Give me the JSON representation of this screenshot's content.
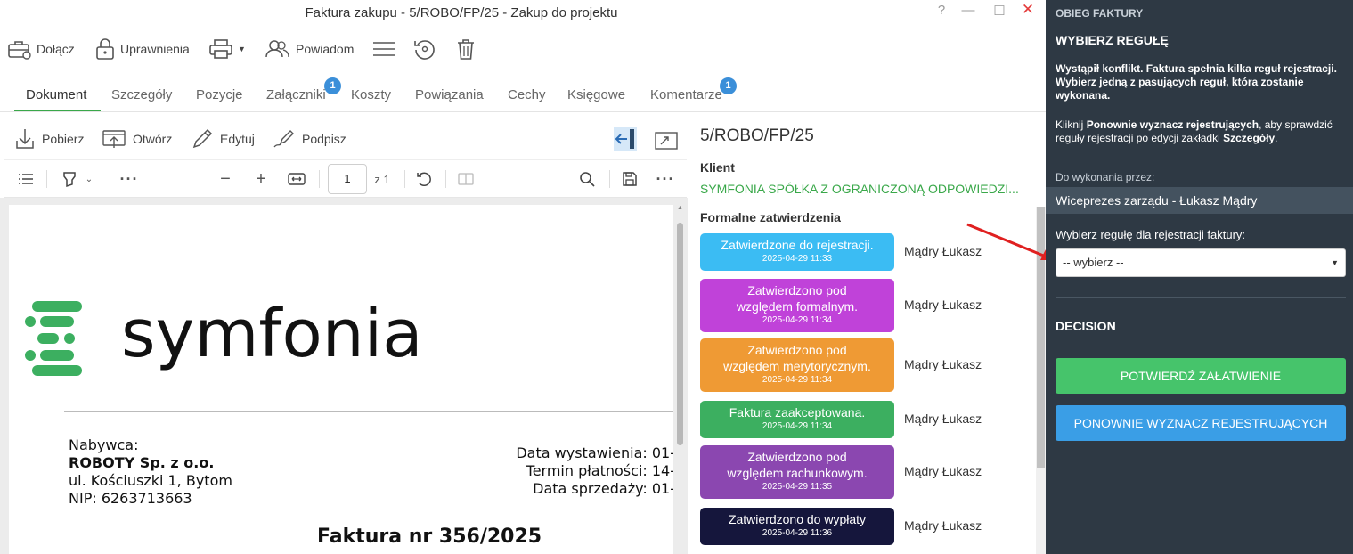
{
  "window": {
    "title": "Faktura zakupu - 5/ROBO/FP/25 - Zakup do projektu",
    "help": "?",
    "minimize": "—",
    "maximize": "☐",
    "close": "✕"
  },
  "toolbar": {
    "attach": "Dołącz",
    "permissions": "Uprawnienia",
    "notify": "Powiadom"
  },
  "tabs": [
    {
      "label": "Dokument"
    },
    {
      "label": "Szczegóły"
    },
    {
      "label": "Pozycje"
    },
    {
      "label": "Załączniki",
      "badge": "1"
    },
    {
      "label": "Koszty"
    },
    {
      "label": "Powiązania"
    },
    {
      "label": "Cechy"
    },
    {
      "label": "Księgowe"
    },
    {
      "label": "Komentarze",
      "badge": "1"
    }
  ],
  "doc_actions": {
    "download": "Pobierz",
    "open": "Otwórz",
    "edit": "Edytuj",
    "sign": "Podpisz"
  },
  "pdf_toolbar": {
    "page": "1",
    "of_pages": "z 1"
  },
  "invoice": {
    "logo_text": "symfonia",
    "buyer_label": "Nabywca:",
    "buyer_name": "ROBOTY Sp. z o.o.",
    "buyer_address": "ul. Kościuszki 1, Bytom",
    "buyer_nip": "NIP: 6263713663",
    "issue_date": "Data wystawienia: 01-",
    "due_date": "Termin płatności: 14-",
    "sale_date": "Data sprzedaży: 01-",
    "number": "Faktura nr 356/2025"
  },
  "details": {
    "doc_number": "5/ROBO/FP/25",
    "client_label": "Klient",
    "client_name": "SYMFONIA SPÓŁKA Z OGRANICZONĄ ODPOWIEDZI...",
    "approvals_label": "Formalne zatwierdzenia",
    "approvals": [
      {
        "line1": "Zatwierdzone do rejestracji.",
        "line2": "",
        "date": "2025-04-29 11:33",
        "user": "Mądry Łukasz",
        "color": "#3bbcf3"
      },
      {
        "line1": "Zatwierdzono pod",
        "line2": "względem formalnym.",
        "date": "2025-04-29 11:34",
        "user": "Mądry Łukasz",
        "color": "#c042d9"
      },
      {
        "line1": "Zatwierdzono pod",
        "line2": "względem merytorycznym.",
        "date": "2025-04-29 11:34",
        "user": "Mądry Łukasz",
        "color": "#ef9a34"
      },
      {
        "line1": "Faktura zaakceptowana.",
        "line2": "",
        "date": "2025-04-29 11:34",
        "user": "Mądry Łukasz",
        "color": "#3caf60"
      },
      {
        "line1": "Zatwierdzono pod",
        "line2": "względem rachunkowym.",
        "date": "2025-04-29 11:35",
        "user": "Mądry Łukasz",
        "color": "#8b47b0"
      },
      {
        "line1": "Zatwierdzono do wypłaty",
        "line2": "",
        "date": "2025-04-29 11:36",
        "user": "Mądry Łukasz",
        "color": "#15163c"
      }
    ]
  },
  "sidebar": {
    "section_label": "OBIEG FAKTURY",
    "heading": "WYBIERZ REGUŁĘ",
    "conflict_text": "Wystąpił konflikt. Faktura spełnia kilka reguł rejestracji. Wybierz jedną z pasujących reguł, która zostanie wykonana.",
    "hint_pre": "Kliknij ",
    "hint_bold1": "Ponownie wyznacz rejestrujących",
    "hint_mid": ", aby sprawdzić reguły rejestracji po edycji zakładki ",
    "hint_bold2": "Szczegóły",
    "hint_post": ".",
    "assignee_label": "Do wykonania przez:",
    "assignee": "Wiceprezes zarządu - Łukasz Mądry",
    "rule_label": "Wybierz regułę dla rejestracji faktury:",
    "rule_select": "-- wybierz --",
    "decision_label": "DECISION",
    "confirm_button": "POTWIERDŹ ZAŁATWIENIE",
    "recalc_button": "PONOWNIE WYZNACZ REJESTRUJĄCYCH",
    "colors": {
      "bg": "#2e3944",
      "confirm": "#46c46b",
      "recalc": "#3a9ee6"
    }
  }
}
